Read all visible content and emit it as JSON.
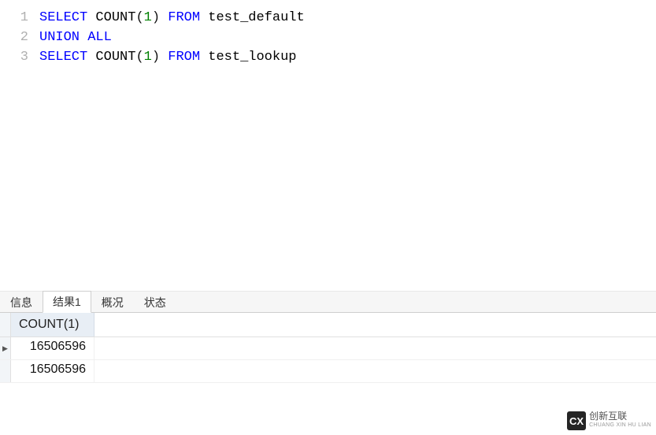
{
  "editor": {
    "lines": [
      {
        "n": "1",
        "tokens": [
          {
            "t": "SELECT",
            "c": "kw"
          },
          {
            "t": " ",
            "c": ""
          },
          {
            "t": "COUNT",
            "c": "ident"
          },
          {
            "t": "(",
            "c": ""
          },
          {
            "t": "1",
            "c": "num"
          },
          {
            "t": ")",
            "c": ""
          },
          {
            "t": " ",
            "c": ""
          },
          {
            "t": "FROM",
            "c": "kw"
          },
          {
            "t": " ",
            "c": ""
          },
          {
            "t": "test_default",
            "c": "ident"
          }
        ]
      },
      {
        "n": "2",
        "tokens": [
          {
            "t": "UNION",
            "c": "kw"
          },
          {
            "t": " ",
            "c": ""
          },
          {
            "t": "ALL",
            "c": "kw"
          }
        ]
      },
      {
        "n": "3",
        "tokens": [
          {
            "t": "SELECT",
            "c": "kw"
          },
          {
            "t": " ",
            "c": ""
          },
          {
            "t": "COUNT",
            "c": "ident"
          },
          {
            "t": "(",
            "c": ""
          },
          {
            "t": "1",
            "c": "num"
          },
          {
            "t": ")",
            "c": ""
          },
          {
            "t": " ",
            "c": ""
          },
          {
            "t": "FROM",
            "c": "kw"
          },
          {
            "t": " ",
            "c": ""
          },
          {
            "t": "test_lookup",
            "c": "ident"
          }
        ]
      }
    ]
  },
  "tabs": {
    "items": [
      {
        "label": "信息",
        "active": false
      },
      {
        "label": "结果1",
        "active": true
      },
      {
        "label": "概况",
        "active": false
      },
      {
        "label": "状态",
        "active": false
      }
    ]
  },
  "result": {
    "column_header": "COUNT(1)",
    "rows": [
      {
        "marker": "▶",
        "value": "16506596"
      },
      {
        "marker": "",
        "value": "16506596"
      }
    ]
  },
  "watermark": {
    "logo_text": "CX",
    "title": "创新互联",
    "subtitle": "CHUANG XIN HU LIAN"
  }
}
